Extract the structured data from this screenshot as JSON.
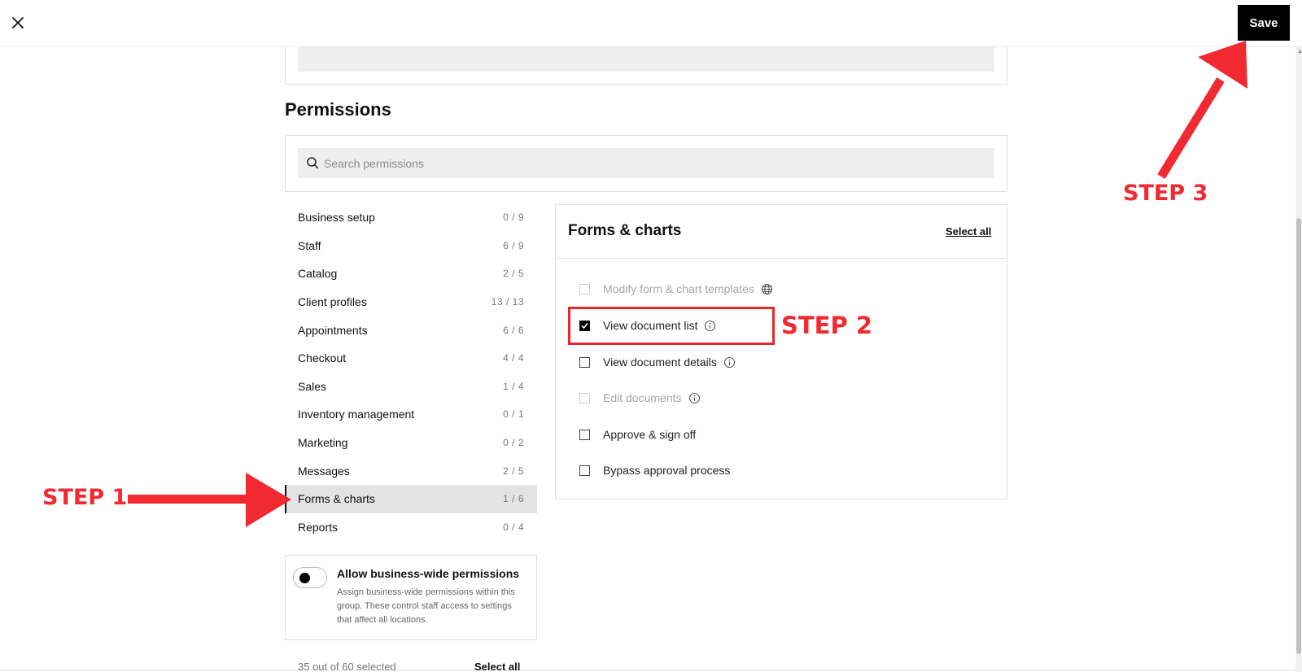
{
  "header": {
    "close_icon": "close-icon",
    "save_label": "Save"
  },
  "permissions": {
    "title": "Permissions",
    "search": {
      "placeholder": "Search permissions",
      "value": ""
    },
    "categories": [
      {
        "label": "Business setup",
        "count": "0 / 9"
      },
      {
        "label": "Staff",
        "count": "6 / 9"
      },
      {
        "label": "Catalog",
        "count": "2 / 5"
      },
      {
        "label": "Client profiles",
        "count": "13 / 13"
      },
      {
        "label": "Appointments",
        "count": "6 / 6"
      },
      {
        "label": "Checkout",
        "count": "4 / 4"
      },
      {
        "label": "Sales",
        "count": "1 / 4"
      },
      {
        "label": "Inventory management",
        "count": "0 / 1"
      },
      {
        "label": "Marketing",
        "count": "0 / 2"
      },
      {
        "label": "Messages",
        "count": "2 / 5"
      },
      {
        "label": "Forms & charts",
        "count": "1 / 6",
        "active": true
      },
      {
        "label": "Reports",
        "count": "0 / 4"
      }
    ],
    "business_wide": {
      "title": "Allow business-wide permissions",
      "description": "Assign business-wide permissions within this group. These control staff access to settings that affect all locations.",
      "enabled": false
    },
    "footer": {
      "selected_text": "35 out of 60 selected",
      "select_all_label": "Select all"
    }
  },
  "detail_panel": {
    "title": "Forms & charts",
    "select_all_label": "Select all",
    "items": [
      {
        "label": "Modify form & chart templates",
        "checked": false,
        "disabled": true,
        "icon": "globe-icon"
      },
      {
        "label": "View document list",
        "checked": true,
        "disabled": false,
        "icon": "info-icon"
      },
      {
        "label": "View document details",
        "checked": false,
        "disabled": false,
        "icon": "info-icon"
      },
      {
        "label": "Edit documents",
        "checked": false,
        "disabled": true,
        "icon": "info-icon"
      },
      {
        "label": "Approve & sign off",
        "checked": false,
        "disabled": false,
        "icon": ""
      },
      {
        "label": "Bypass approval process",
        "checked": false,
        "disabled": false,
        "icon": ""
      }
    ]
  },
  "annotations": {
    "step1": "STEP 1",
    "step2": "STEP 2",
    "step3": "STEP 3",
    "color": "#f02a30"
  }
}
